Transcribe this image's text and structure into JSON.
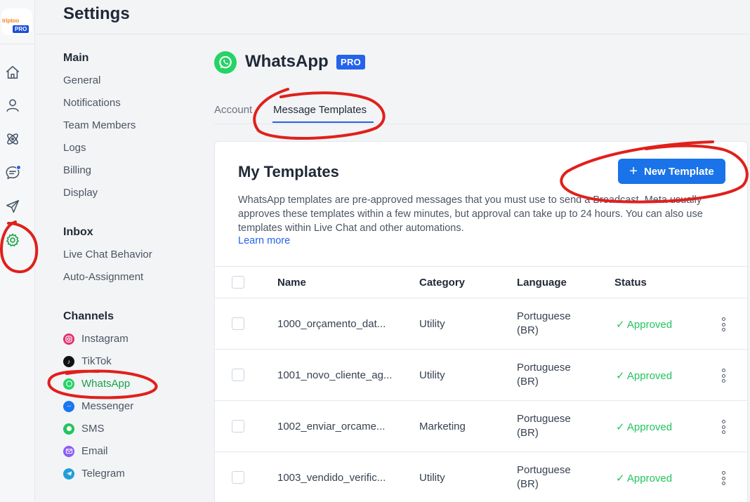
{
  "brand": {
    "logo_word": "triptoo",
    "logo_pro": "PRO"
  },
  "settings_title": "Settings",
  "nav": {
    "main_heading": "Main",
    "main_items": [
      "General",
      "Notifications",
      "Team Members",
      "Logs",
      "Billing",
      "Display"
    ],
    "inbox_heading": "Inbox",
    "inbox_items": [
      "Live Chat Behavior",
      "Auto-Assignment"
    ],
    "channels_heading": "Channels",
    "channels": [
      {
        "label": "Instagram",
        "icon": "instagram-icon",
        "color": "#e1306c"
      },
      {
        "label": "TikTok",
        "icon": "tiktok-icon",
        "color": "#111111"
      },
      {
        "label": "WhatsApp",
        "icon": "whatsapp-icon",
        "color": "#25d366"
      },
      {
        "label": "Messenger",
        "icon": "messenger-icon",
        "color": "#1877f2"
      },
      {
        "label": "SMS",
        "icon": "sms-icon",
        "color": "#22c55e"
      },
      {
        "label": "Email",
        "icon": "email-icon",
        "color": "#8b5cf6"
      },
      {
        "label": "Telegram",
        "icon": "telegram-icon",
        "color": "#229ed9"
      }
    ]
  },
  "page": {
    "title": "WhatsApp",
    "badge": "PRO"
  },
  "tabs": [
    {
      "label": "Account",
      "active": false
    },
    {
      "label": "Message Templates",
      "active": true
    }
  ],
  "card": {
    "title": "My Templates",
    "new_button": "New Template",
    "description": "WhatsApp templates are pre-approved messages that you must use to send a Broadcast. Meta usually approves these templates within a few minutes, but approval can take up to 24 hours. You can also use templates within Live Chat and other automations.",
    "learn_more": "Learn more"
  },
  "table": {
    "columns": [
      "Name",
      "Category",
      "Language",
      "Status"
    ],
    "rows": [
      {
        "name": "1000_orçamento_dat...",
        "category": "Utility",
        "language": "Portuguese (BR)",
        "status": "✓ Approved"
      },
      {
        "name": "1001_novo_cliente_ag...",
        "category": "Utility",
        "language": "Portuguese (BR)",
        "status": "✓ Approved"
      },
      {
        "name": "1002_enviar_orcame...",
        "category": "Marketing",
        "language": "Portuguese (BR)",
        "status": "✓ Approved"
      },
      {
        "name": "1003_vendido_verific...",
        "category": "Utility",
        "language": "Portuguese (BR)",
        "status": "✓ Approved"
      }
    ]
  },
  "colors": {
    "accent": "#1a73e8",
    "active_green": "#16a34a",
    "annotation_red": "#e0201b"
  }
}
